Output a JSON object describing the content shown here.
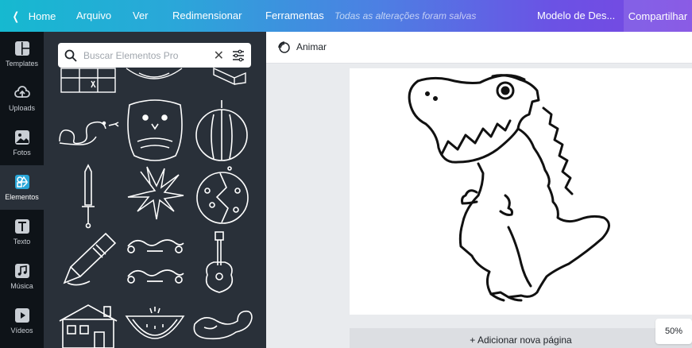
{
  "topbar": {
    "home_label": "Home",
    "menu": [
      "Arquivo",
      "Ver",
      "Redimensionar",
      "Ferramentas"
    ],
    "status": "Todas as alterações foram salvas",
    "doc_title": "Modelo de Des...",
    "share_label": "Compartilhar"
  },
  "sidebar": {
    "items": [
      {
        "label": "Templates",
        "icon": "templates-icon"
      },
      {
        "label": "Uploads",
        "icon": "upload-icon"
      },
      {
        "label": "Fotos",
        "icon": "photos-icon"
      },
      {
        "label": "Elementos",
        "icon": "elements-icon",
        "active": true
      },
      {
        "label": "Texto",
        "icon": "text-icon"
      },
      {
        "label": "Música",
        "icon": "music-icon"
      },
      {
        "label": "Vídeos",
        "icon": "video-icon"
      }
    ]
  },
  "search": {
    "placeholder": "Buscar Elementos Pro",
    "value": ""
  },
  "editor": {
    "animate_label": "Animar",
    "add_page_label": "+ Adicionar nova página",
    "zoom": "50%"
  },
  "colors": {
    "accent": "#00c4cc",
    "brand_gradient_start": "#16b9d0",
    "brand_gradient_end": "#7a45e2",
    "panel_bg": "#293039",
    "rail_bg": "#0e1318"
  }
}
